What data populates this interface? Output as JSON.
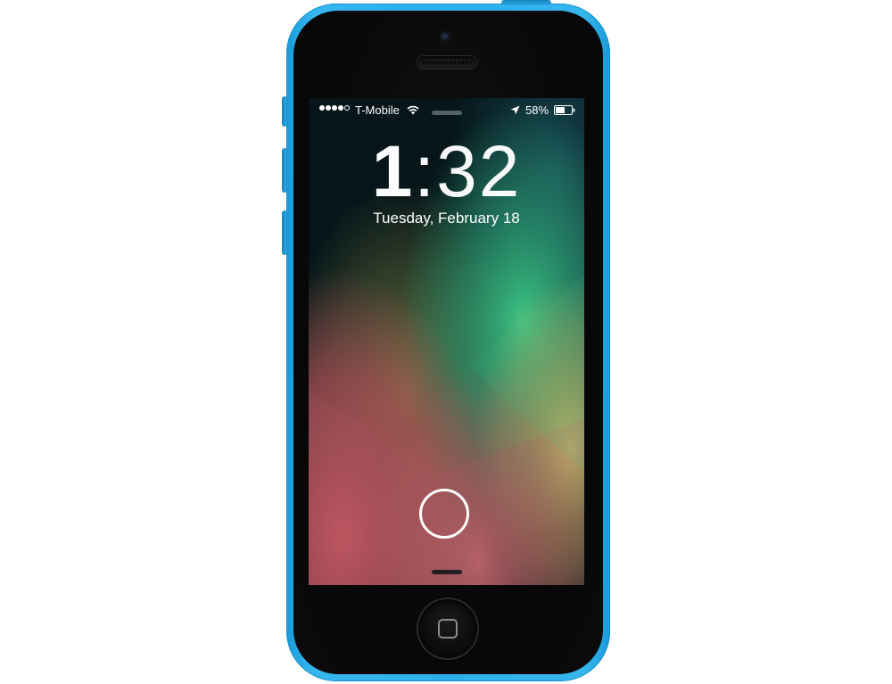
{
  "status_bar": {
    "signal_bars_filled": 4,
    "signal_bars_total": 5,
    "carrier": "T-Mobile",
    "wifi_icon": "wifi-icon",
    "location_icon": "location-arrow-icon",
    "battery_percent": "58%",
    "battery_level": 0.58
  },
  "lock_screen": {
    "time_hour": "1",
    "time_separator": ":",
    "time_minutes": "32",
    "date": "Tuesday, February 18",
    "unlock_icon": "unlock-ring-icon"
  },
  "device": {
    "model_color": "#2ab0ec",
    "home_button_icon": "home-square-icon"
  },
  "colors": {
    "phone_body": "#2ab0ec",
    "screen_text": "#ffffff"
  }
}
